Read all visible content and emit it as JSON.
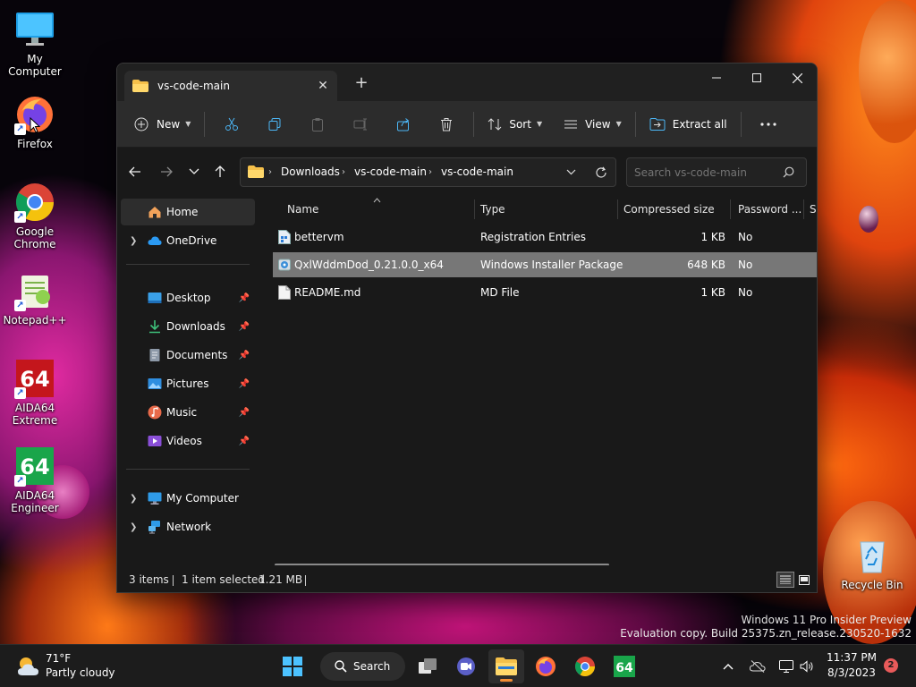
{
  "desktop": {
    "icons": [
      {
        "label": "My Computer"
      },
      {
        "label": "Firefox"
      },
      {
        "label": "Google Chrome"
      },
      {
        "label": "Notepad++"
      },
      {
        "label": "AIDA64 Extreme"
      },
      {
        "label": "AIDA64 Engineer"
      },
      {
        "label": "Recycle Bin"
      }
    ],
    "watermark_line1": "Windows 11 Pro Insider Preview",
    "watermark_line2": "Evaluation copy. Build 25375.zn_release.230520-1632"
  },
  "window": {
    "tab_title": "vs-code-main",
    "toolbar": {
      "new_label": "New",
      "sort_label": "Sort",
      "view_label": "View",
      "extract_label": "Extract all"
    },
    "address": {
      "crumbs": [
        "Downloads",
        "vs-code-main",
        "vs-code-main"
      ],
      "search_placeholder": "Search vs-code-main"
    },
    "sidebar": {
      "items": [
        {
          "label": "Home"
        },
        {
          "label": "OneDrive"
        },
        {
          "label": "Desktop"
        },
        {
          "label": "Downloads"
        },
        {
          "label": "Documents"
        },
        {
          "label": "Pictures"
        },
        {
          "label": "Music"
        },
        {
          "label": "Videos"
        },
        {
          "label": "My Computer"
        },
        {
          "label": "Network"
        }
      ]
    },
    "columns": [
      "Name",
      "Type",
      "Compressed size",
      "Password ...",
      "Si"
    ],
    "files": [
      {
        "name": "bettervm",
        "type": "Registration Entries",
        "size": "1 KB",
        "password": "No"
      },
      {
        "name": "QxlWddmDod_0.21.0.0_x64",
        "type": "Windows Installer Package",
        "size": "648 KB",
        "password": "No"
      },
      {
        "name": "README.md",
        "type": "MD File",
        "size": "1 KB",
        "password": "No"
      }
    ],
    "status": {
      "items": "3 items",
      "selected": "1 item selected",
      "size": "1.21 MB"
    }
  },
  "taskbar": {
    "weather_temp": "71°F",
    "weather_desc": "Partly cloudy",
    "search_label": "Search",
    "time": "11:37 PM",
    "date": "8/3/2023",
    "notification_count": "2"
  },
  "colors": {
    "accent": "#f28d33",
    "selection": "#777777",
    "window_bg": "#191919",
    "toolbar_bg": "#2c2c2c"
  }
}
